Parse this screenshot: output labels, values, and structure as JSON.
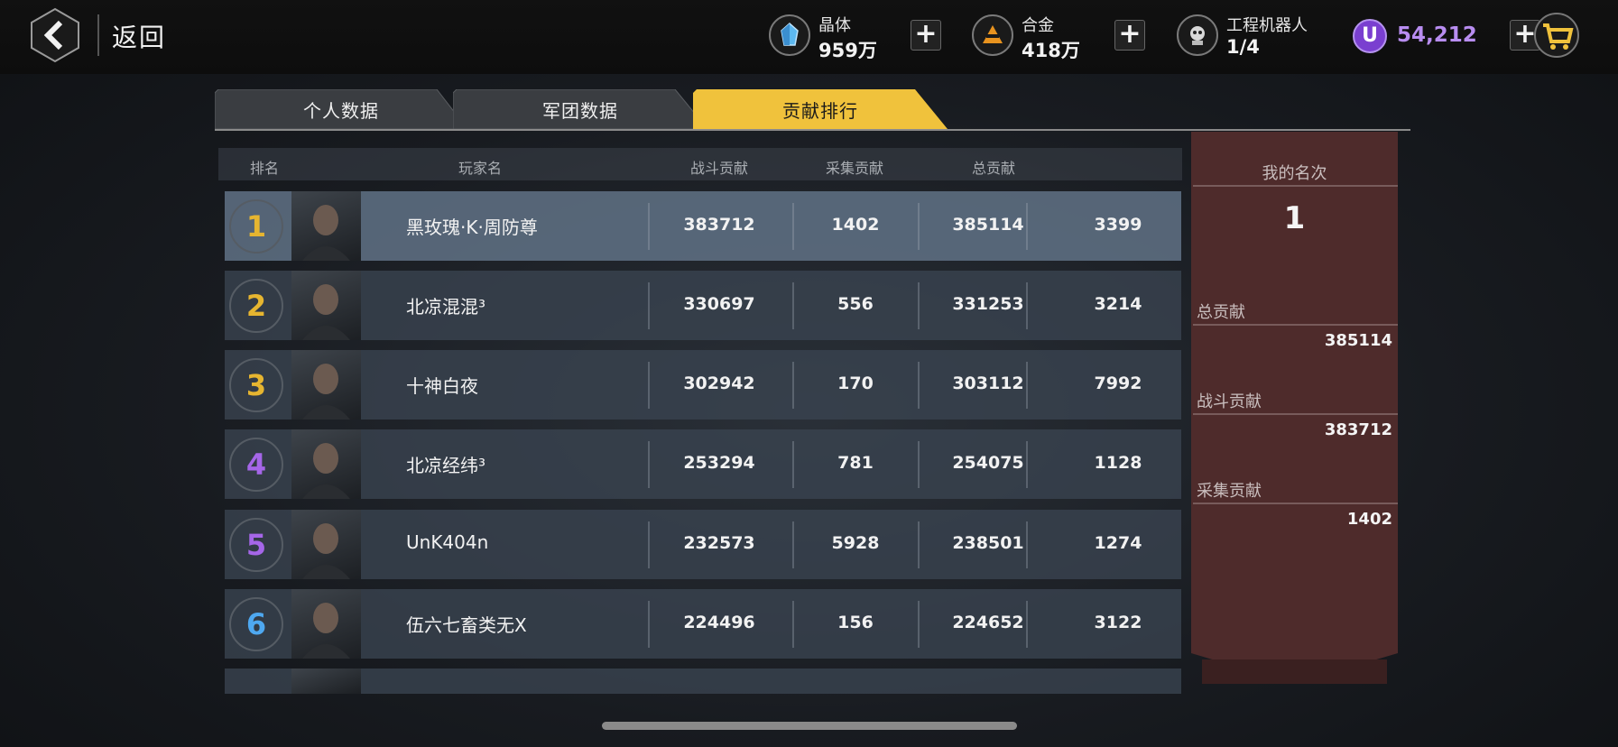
{
  "topbar": {
    "back_label": "返回",
    "resources": [
      {
        "name": "晶体",
        "value": "959万",
        "icon": "crystal-icon"
      },
      {
        "name": "合金",
        "value": "418万",
        "icon": "alloy-icon"
      },
      {
        "name": "工程机器人",
        "value": "1/4",
        "icon": "robot-icon"
      }
    ],
    "currency_symbol": "U",
    "currency_value": "54,212",
    "plus": "+"
  },
  "tabs": [
    {
      "label": "个人数据",
      "active": false
    },
    {
      "label": "军团数据",
      "active": false
    },
    {
      "label": "贡献排行",
      "active": true
    }
  ],
  "table": {
    "headers": [
      "排名",
      "玩家名",
      "战斗贡献",
      "采集贡献",
      "总贡献"
    ],
    "rows": [
      {
        "rank": "1",
        "name": "黑玫瑰·K·周防尊",
        "battle": "383712",
        "collect": "1402",
        "total": "385114",
        "extra": "3399",
        "rank_color": "#e6b530"
      },
      {
        "rank": "2",
        "name": "北凉混混³",
        "battle": "330697",
        "collect": "556",
        "total": "331253",
        "extra": "3214",
        "rank_color": "#e6b530"
      },
      {
        "rank": "3",
        "name": "十神白夜",
        "battle": "302942",
        "collect": "170",
        "total": "303112",
        "extra": "7992",
        "rank_color": "#e6b530"
      },
      {
        "rank": "4",
        "name": "北凉经纬³",
        "battle": "253294",
        "collect": "781",
        "total": "254075",
        "extra": "1128",
        "rank_color": "#a566e8"
      },
      {
        "rank": "5",
        "name": "UnK404n",
        "battle": "232573",
        "collect": "5928",
        "total": "238501",
        "extra": "1274",
        "rank_color": "#a566e8"
      },
      {
        "rank": "6",
        "name": "伍六七畜类无X",
        "battle": "224496",
        "collect": "156",
        "total": "224652",
        "extra": "3122",
        "rank_color": "#4ea8f0"
      }
    ]
  },
  "panel": {
    "title": "我的名次",
    "rank": "1",
    "total_label": "总贡献",
    "total_value": "385114",
    "battle_label": "战斗贡献",
    "battle_value": "383712",
    "collect_label": "采集贡献",
    "collect_value": "1402"
  },
  "colors": {
    "active_tab": "#f0c23c",
    "inactive_tab": "#3a3d41",
    "panel": "#5a2e2e",
    "currency": "#b88df0"
  }
}
